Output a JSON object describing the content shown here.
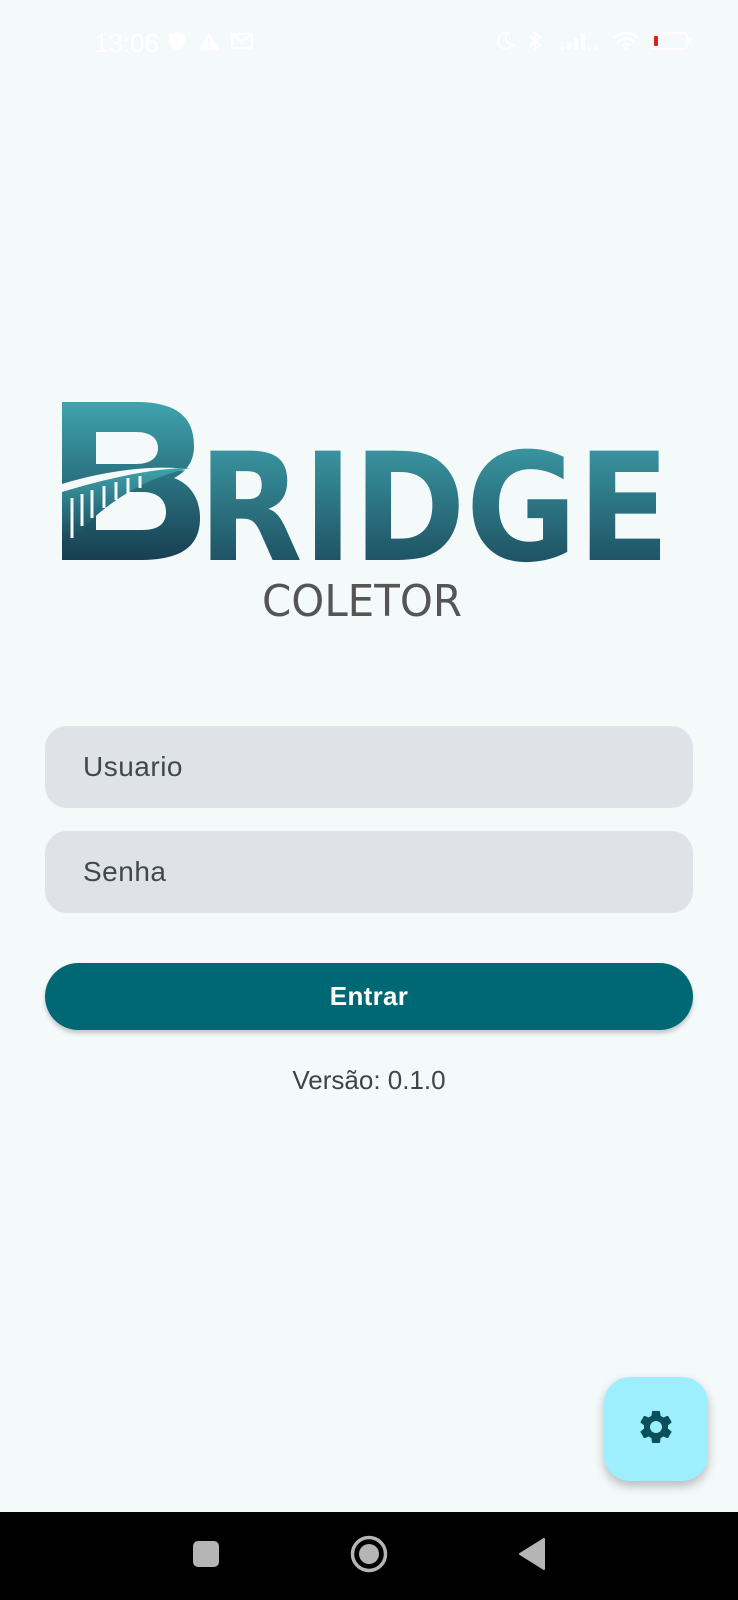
{
  "status_bar": {
    "time": "13:06",
    "icons_left": [
      "shield-icon",
      "warning-icon",
      "mail-icon"
    ],
    "icons_right": [
      "moon-icon",
      "bluetooth-icon",
      "signal-icon",
      "wifi-icon",
      "battery-icon"
    ],
    "battery_level": 0.12,
    "battery_color": "#e02020"
  },
  "logo": {
    "title": "BRIDGE",
    "subtitle": "COLETOR"
  },
  "login_form": {
    "username_placeholder": "Usuario",
    "username_value": "",
    "password_placeholder": "Senha",
    "password_value": "",
    "submit_label": "Entrar"
  },
  "version_text": "Versão: 0.1.0",
  "fab": {
    "icon": "gear-icon"
  },
  "nav_bar": {
    "buttons": [
      "recents-button",
      "home-button",
      "back-button"
    ]
  },
  "colors": {
    "primary": "#006874",
    "background": "#f4f9fa",
    "field_background": "#dfe3e7",
    "fab_background": "#9eeffd",
    "logo_dark": "#1a4f62",
    "logo_light": "#3fa3ad",
    "subtitle_text": "#555555"
  }
}
